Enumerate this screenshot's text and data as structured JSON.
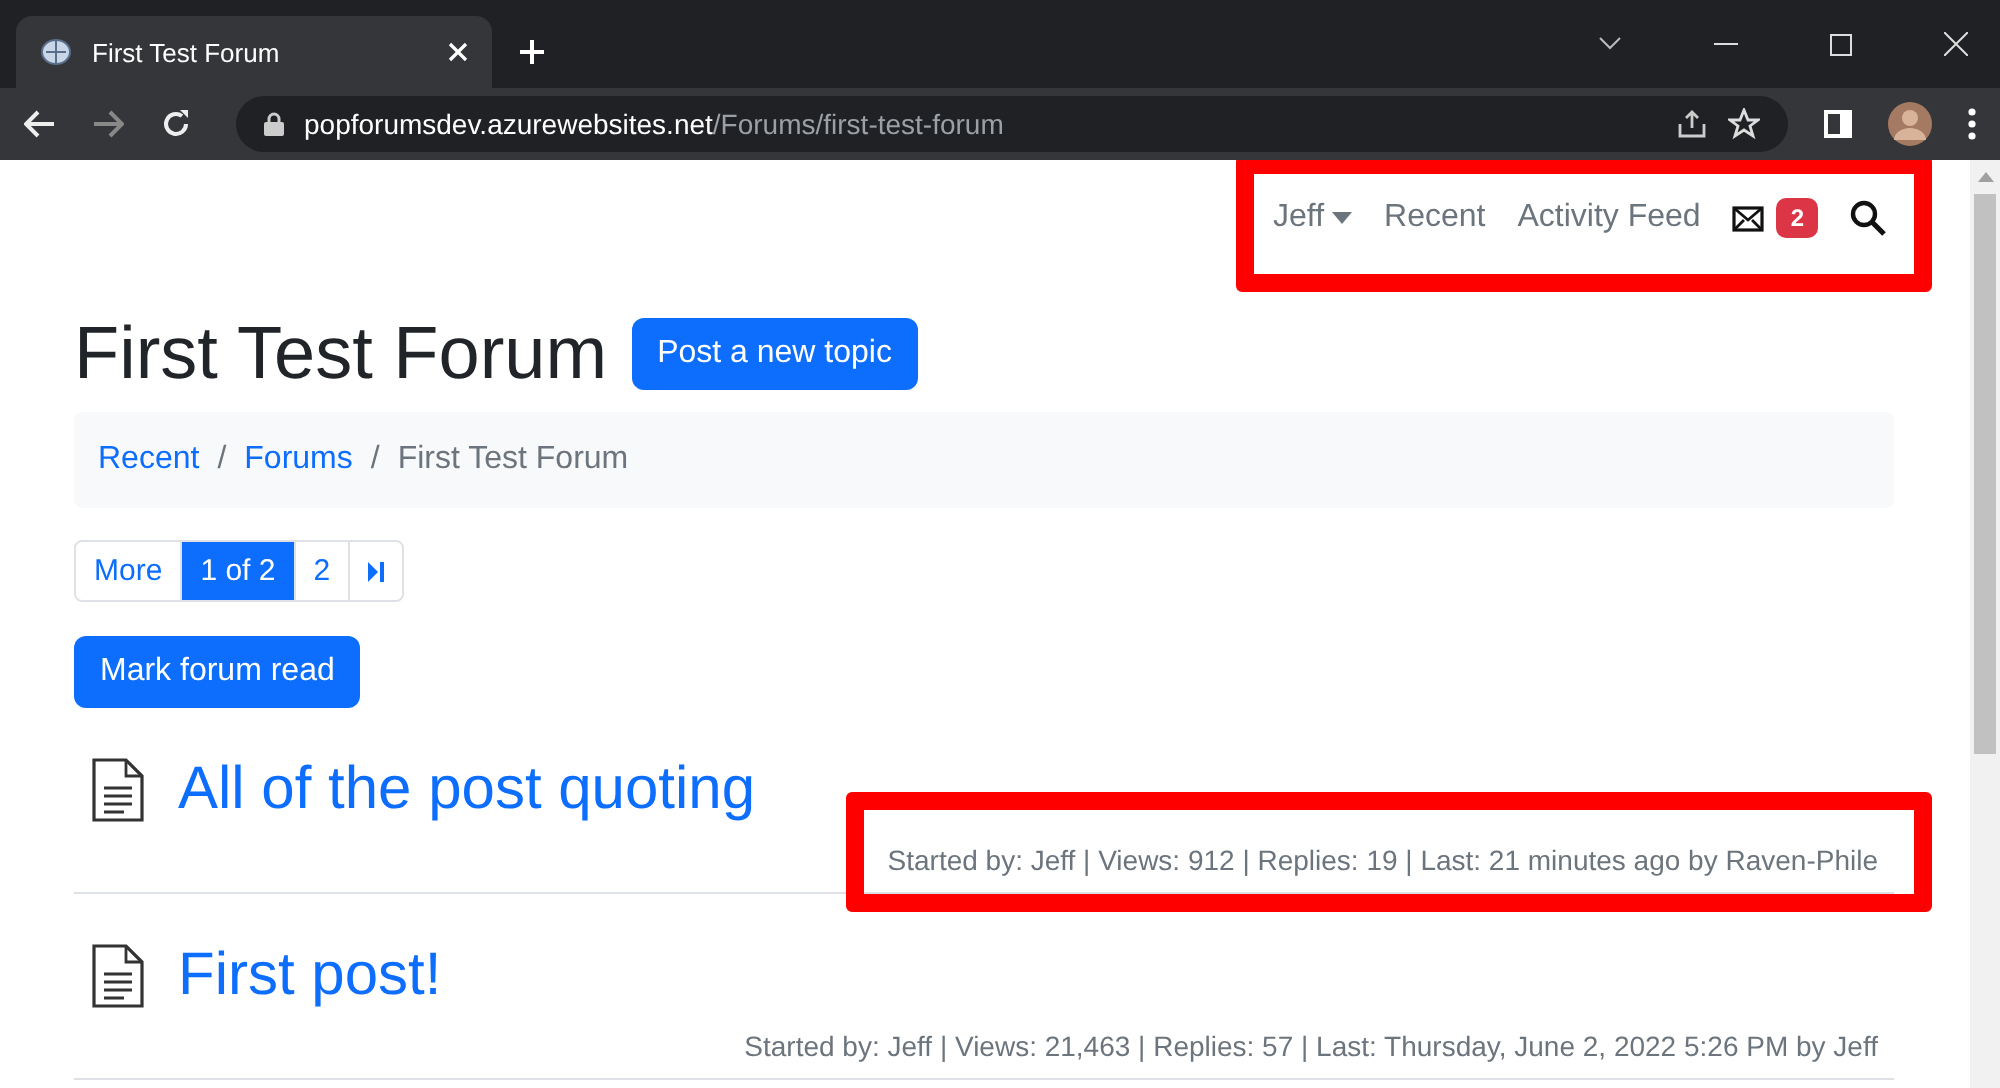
{
  "browser": {
    "tab_title": "First Test Forum",
    "url_host": "popforumsdev.azurewebsites.net",
    "url_path": "/Forums/first-test-forum"
  },
  "nav": {
    "user": "Jeff",
    "links": [
      "Recent",
      "Activity Feed"
    ],
    "message_count": "2"
  },
  "title": "First Test Forum",
  "new_topic_button": "Post a new topic",
  "breadcrumbs": [
    {
      "label": "Recent",
      "link": true
    },
    {
      "separator": "/",
      "label": "Forums",
      "link": true
    },
    {
      "separator": "/",
      "label": "First Test Forum",
      "link": false
    }
  ],
  "pagination": [
    {
      "label": "More",
      "kind": "text",
      "selected": false
    },
    {
      "label": "1 of 2",
      "kind": "text",
      "selected": true
    },
    {
      "label": "2",
      "kind": "text",
      "selected": false
    },
    {
      "kind": "last",
      "selected": false
    }
  ],
  "mark_read_button": "Mark forum read",
  "topics": [
    {
      "title": "All of the post quoting",
      "meta": "Started by: Jeff | Views: 912 | Replies: 19 | Last: 21 minutes ago by Raven-Phile",
      "highlighted": true
    },
    {
      "title": "First post!",
      "meta": "Started by: Jeff | Views: 21,463 | Replies: 57 | Last: Thursday, June 2, 2022 5:26 PM by Jeff",
      "highlighted": false
    }
  ],
  "nav_highlighted": true
}
